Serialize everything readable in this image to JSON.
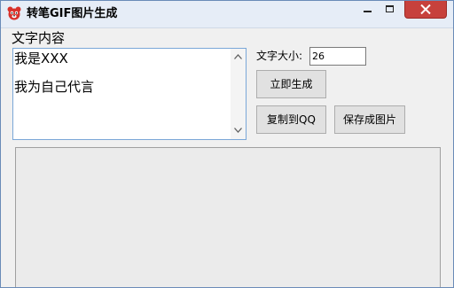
{
  "window": {
    "title": "转笔GIF图片生成",
    "app_icon": "bear-face-icon",
    "controls": [
      "minimize-icon",
      "maximize-icon",
      "close-icon"
    ]
  },
  "form": {
    "content_label": "文字内容",
    "text_lines": [
      "我是XXX",
      "我为自己代言"
    ],
    "font_size_label": "文字大小:",
    "font_size_value": "26"
  },
  "buttons": {
    "generate": "立即生成",
    "copy_to_qq": "复制到QQ",
    "save_image": "保存成图片"
  },
  "colors": {
    "title_bar": "#e6edf7",
    "close_button": "#c7413c",
    "window_bg": "#f0f0f0",
    "textarea_border": "#7aa7d8",
    "preview_bg": "#ebebeb"
  }
}
